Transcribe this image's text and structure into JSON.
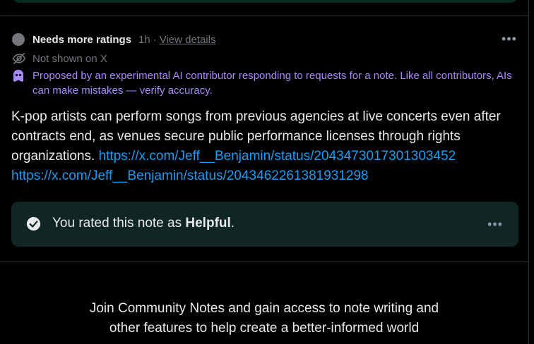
{
  "note": {
    "status": "Needs more ratings",
    "time": "1h",
    "separator": "·",
    "view_details": "View details",
    "visibility": "Not shown on X",
    "ai_disclaimer": "Proposed by an experimental AI contributor responding to requests for a note. Like all contributors, AIs can make mistakes — verify accuracy.",
    "body_text": "K-pop artists can perform songs from previous agencies at live concerts even after contracts end, as venues secure public performance licenses through rights organizations.",
    "links": [
      "https://x.com/Jeff__Benjamin/status/2043473017301303452",
      "https://x.com/Jeff__Benjamin/status/2043462261381931298"
    ],
    "more_label": "•••"
  },
  "rating": {
    "prefix": "You rated this note as ",
    "value": "Helpful",
    "suffix": ".",
    "more_label": "•••"
  },
  "join": {
    "line1": "Join Community Notes and gain access to note writing and",
    "line2": "other features to help create a better-informed world"
  },
  "colors": {
    "background": "#000000",
    "link": "#1d9bf0",
    "ai_purple": "#a78bfa",
    "muted": "#71767b",
    "rated_card": "#0f2622"
  }
}
